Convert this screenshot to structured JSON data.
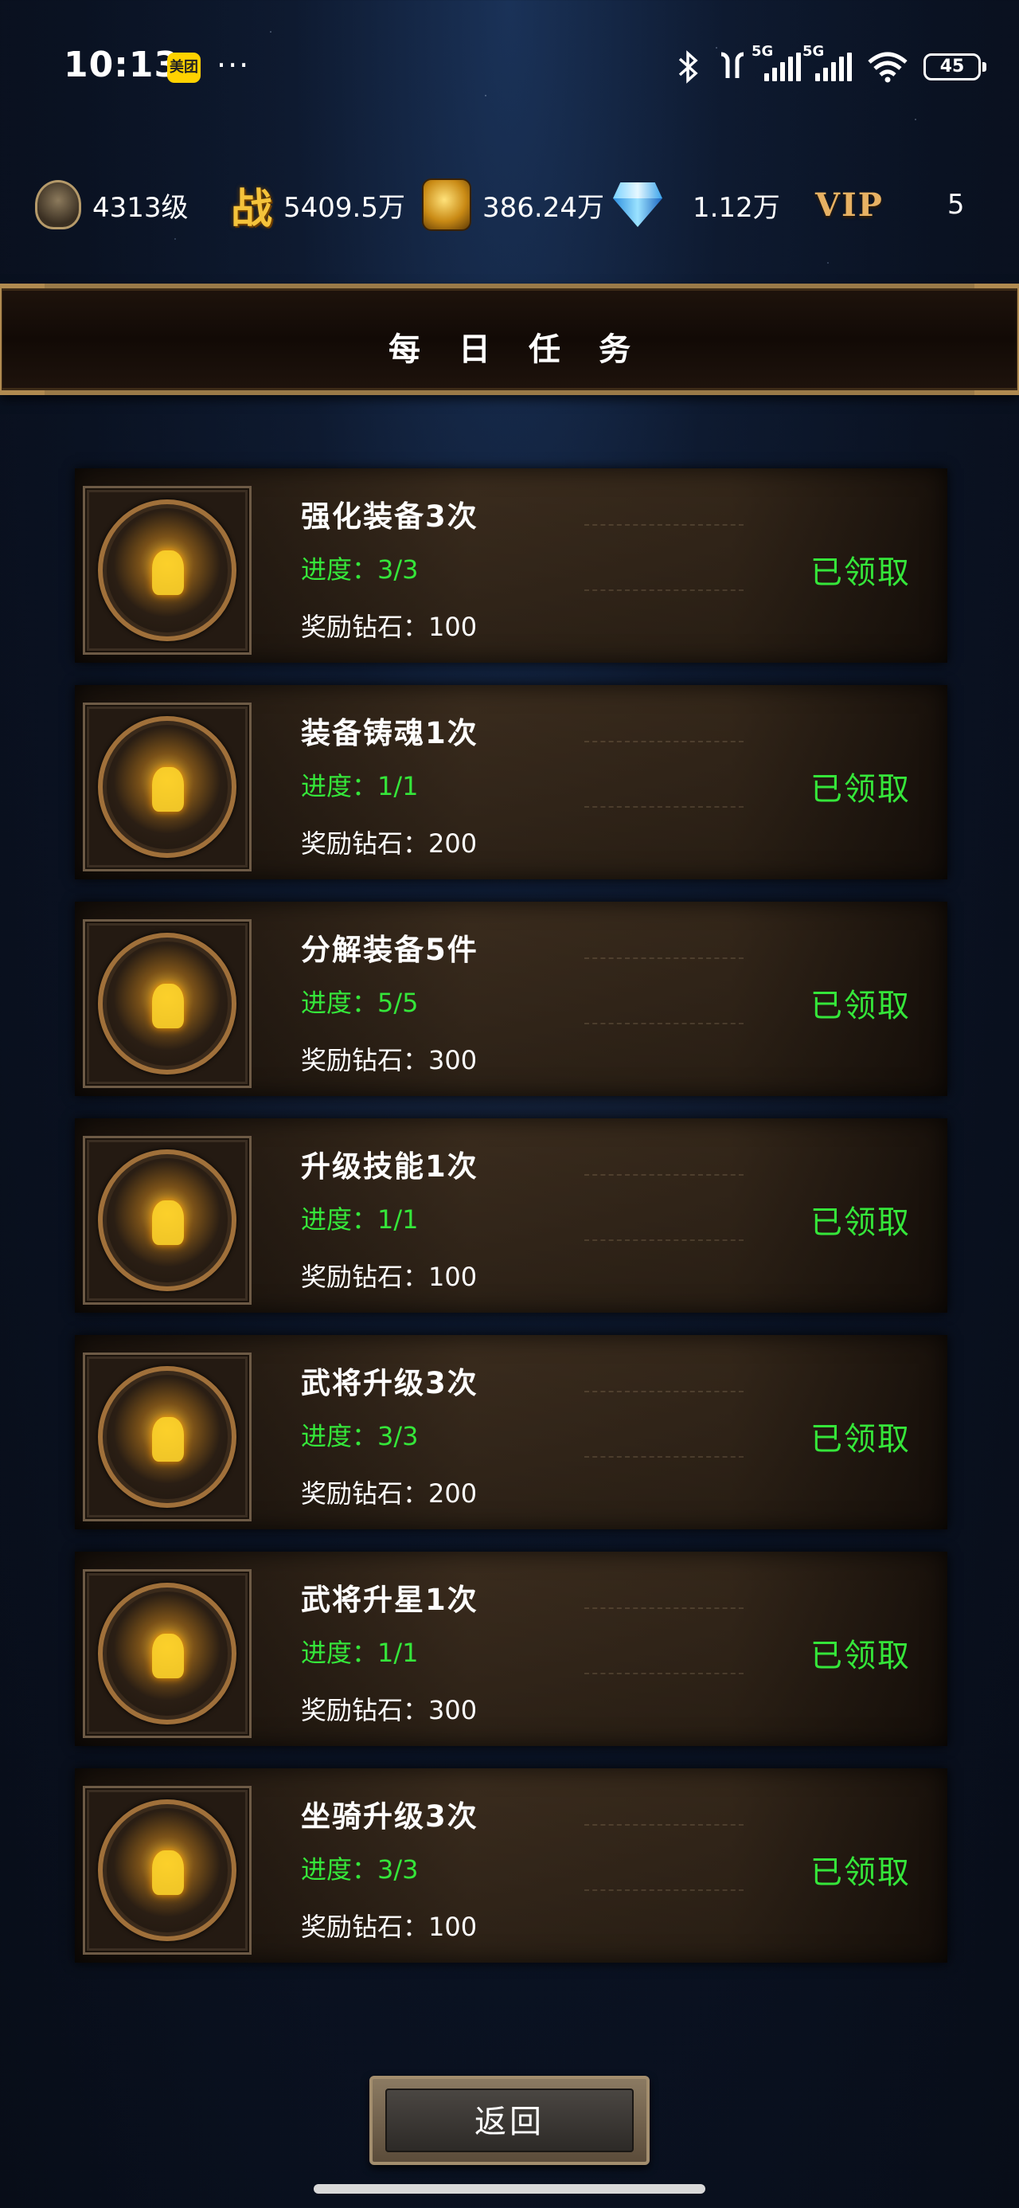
{
  "statusbar": {
    "time": "10:13",
    "app_badge": "美团",
    "more": "···",
    "network_1": "5G",
    "network_2": "5G",
    "battery": "45"
  },
  "resources": {
    "level": "4313级",
    "power_icon": "战",
    "power": "5409.5万",
    "gold": "386.24万",
    "diamond": "1.12万",
    "vip_label": "VIP",
    "vip_level": "5"
  },
  "title": "每日任务",
  "tasks": [
    {
      "name": "强化装备3次",
      "progress": "进度：3/3",
      "reward": "奖励钻石：100",
      "status": "已领取"
    },
    {
      "name": "装备铸魂1次",
      "progress": "进度：1/1",
      "reward": "奖励钻石：200",
      "status": "已领取"
    },
    {
      "name": "分解装备5件",
      "progress": "进度：5/5",
      "reward": "奖励钻石：300",
      "status": "已领取"
    },
    {
      "name": "升级技能1次",
      "progress": "进度：1/1",
      "reward": "奖励钻石：100",
      "status": "已领取"
    },
    {
      "name": "武将升级3次",
      "progress": "进度：3/3",
      "reward": "奖励钻石：200",
      "status": "已领取"
    },
    {
      "name": "武将升星1次",
      "progress": "进度：1/1",
      "reward": "奖励钻石：300",
      "status": "已领取"
    },
    {
      "name": "坐骑升级3次",
      "progress": "进度：3/3",
      "reward": "奖励钻石：100",
      "status": "已领取"
    }
  ],
  "back_label": "返回",
  "colors": {
    "progress_green": "#35e63a",
    "frame_gold": "#9a7a48",
    "vip_gold": "#e7b163"
  },
  "icons": {
    "rank": "rank-emblem-icon",
    "power": "battle-power-icon",
    "gold": "gold-coin-icon",
    "diamond": "diamond-icon",
    "task": "dragon-mask-icon"
  }
}
